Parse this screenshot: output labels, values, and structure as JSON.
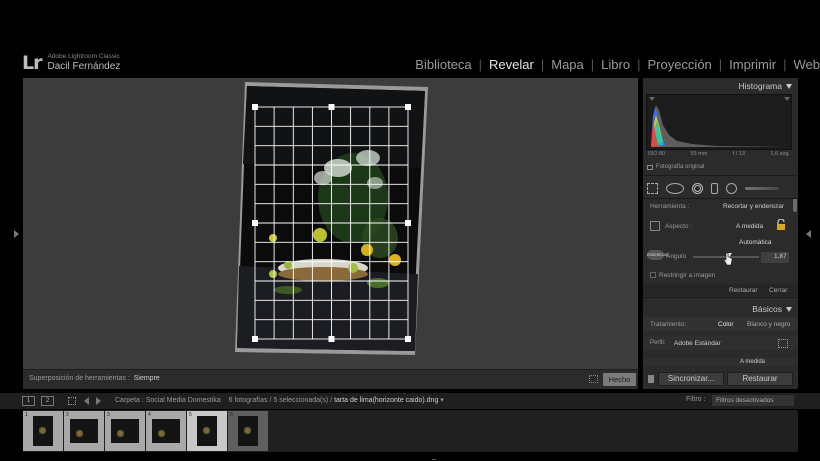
{
  "identity": {
    "logo": "Lr",
    "app_name": "Adobe Lightroom Classic",
    "user_name": "Dacil Fernández"
  },
  "modules": [
    {
      "label": "Biblioteca",
      "active": false
    },
    {
      "label": "Revelar",
      "active": true
    },
    {
      "label": "Mapa",
      "active": false
    },
    {
      "label": "Libro",
      "active": false
    },
    {
      "label": "Proyección",
      "active": false
    },
    {
      "label": "Imprimir",
      "active": false
    },
    {
      "label": "Web",
      "active": false
    }
  ],
  "toolbar": {
    "overlay_label": "Superposición de herramientas :",
    "overlay_value": "Siempre",
    "done_label": "Hecho"
  },
  "histogram": {
    "title": "Histograma",
    "iso": "ISO 80",
    "focal": "55 mm",
    "aperture": "f / 13",
    "shutter": "1,6 seg.",
    "original_label": "Fotografía original"
  },
  "crop_tool": {
    "tool_label": "Herramienta :",
    "tool_value": "Recortar y enderezar",
    "aspect_label": "Aspecto :",
    "aspect_value": "A medida",
    "auto_label": "Automática",
    "angle_icon_text": "ENDEREZAR",
    "angle_label": "Ángulo",
    "angle_value": "1,87",
    "constrain_label": "Restringir a imagen",
    "restore_label": "Restaurar",
    "close_label": "Cerrar"
  },
  "basics": {
    "title": "Básicos",
    "treatment_label": "Tratamiento:",
    "color_label": "Color",
    "bw_label": "Blanco y negro",
    "profile_label": "Perfil:",
    "profile_value": "Adobe Estándar",
    "partial_value": "A medida"
  },
  "sync": {
    "sync_label": "Sincronizar...",
    "restore_label": "Restaurar"
  },
  "filmstrip_header": {
    "view1": "1",
    "view2": "2",
    "folder_label": "Carpeta : Social Media Domestika",
    "count_label": "6 fotografías / 5 seleccionada(s) /",
    "file_name": "tarta de lima(horizonte caido).dng",
    "filter_label": "Filtro :",
    "filter_value": "Filtros desactivados"
  },
  "filmstrip": [
    {
      "num": "1",
      "state": "selected"
    },
    {
      "num": "2",
      "state": "selected"
    },
    {
      "num": "3",
      "state": "selected"
    },
    {
      "num": "4",
      "state": "selected"
    },
    {
      "num": "5",
      "state": "current"
    },
    {
      "num": "6",
      "state": "normal"
    }
  ],
  "colors": {
    "accent_active": "#e6e6e6",
    "panel_bg": "#2b2b2b",
    "canvas_bg": "#3c3c3c"
  }
}
